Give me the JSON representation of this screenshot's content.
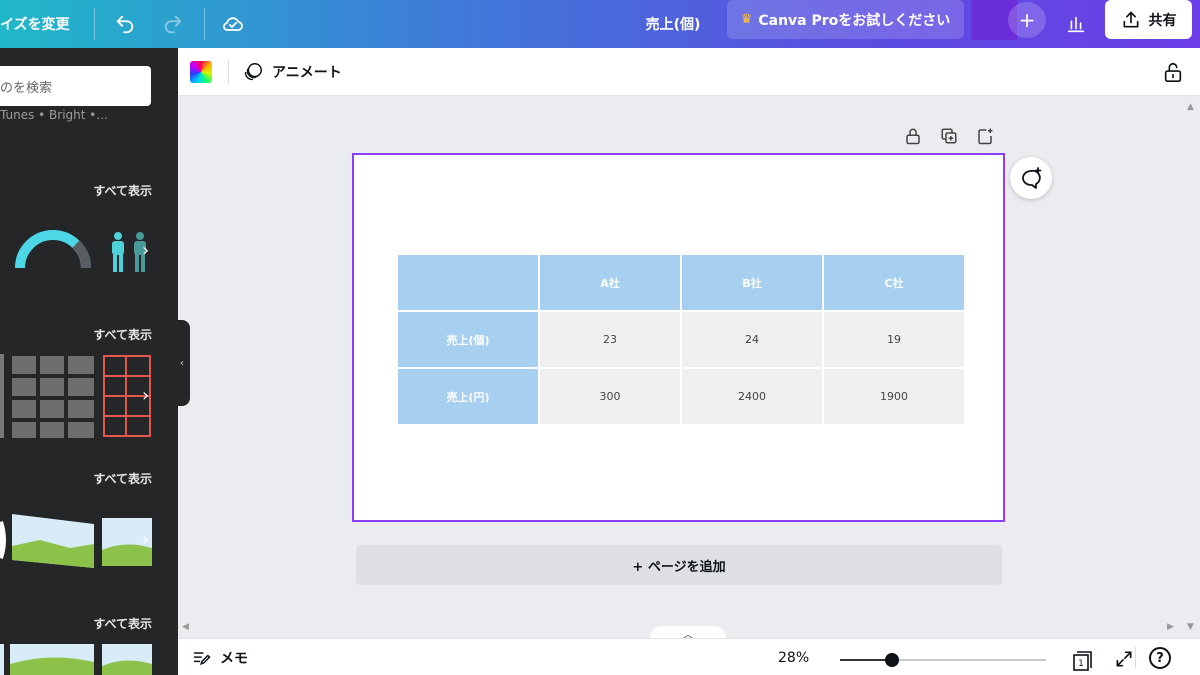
{
  "topbar": {
    "resize_label": "イズを変更",
    "doc_title": "売上(個)",
    "pro_label": "Canva Proをお試しください",
    "pro_icon": "crown-icon",
    "plus_label": "+",
    "share_label": "共有"
  },
  "sidebar": {
    "search_placeholder": "のを検索",
    "hint": "Tunes • Bright •...",
    "sections": [
      {
        "see_all": "すべて表示"
      },
      {
        "see_all": "すべて表示"
      },
      {
        "see_all": "すべて表示"
      },
      {
        "see_all": "すべて表示"
      }
    ]
  },
  "toolbar": {
    "animate_label": "アニメート"
  },
  "table": {
    "header": [
      "",
      "A社",
      "B社",
      "C社"
    ],
    "rows": [
      {
        "label": "売上(個)",
        "values": [
          "23",
          "24",
          "19"
        ]
      },
      {
        "label": "売上(円)",
        "values": [
          "300",
          "2400",
          "1900"
        ]
      }
    ]
  },
  "canvas": {
    "add_page_label": "+ ページを追加"
  },
  "bottombar": {
    "memo_label": "メモ",
    "zoom": "28%",
    "zoom_fraction": 0.25,
    "page_count": "1",
    "help_label": "?"
  },
  "colors": {
    "accent": "#8b3dff",
    "table_header": "#a7cff0",
    "table_cell": "#efefef"
  }
}
